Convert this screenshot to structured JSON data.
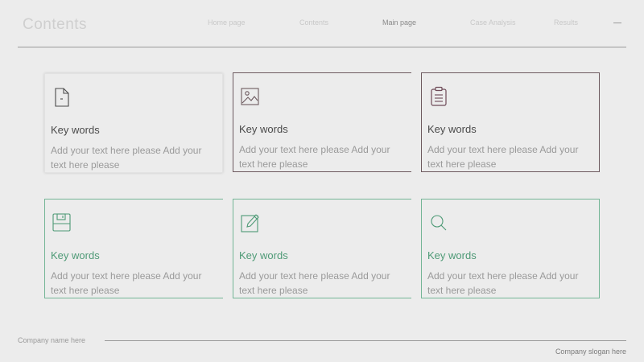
{
  "header": {
    "title": "Contents",
    "nav": [
      {
        "label": "Home page",
        "active": false
      },
      {
        "label": "Contents",
        "active": false
      },
      {
        "label": "Main page",
        "active": true
      },
      {
        "label": "Case Analysis",
        "active": false
      },
      {
        "label": "Results",
        "active": false
      }
    ]
  },
  "cards": [
    {
      "icon": "document-icon",
      "heading": "Key words",
      "body": "Add your text here please Add your text here please"
    },
    {
      "icon": "image-icon",
      "heading": "Key words",
      "body": "Add your text here please Add your text here please"
    },
    {
      "icon": "clipboard-icon",
      "heading": "Key words",
      "body": "Add your text here please Add your text here please"
    },
    {
      "icon": "save-icon",
      "heading": "Key words",
      "body": "Add your text here please Add your text here please"
    },
    {
      "icon": "edit-icon",
      "heading": "Key words",
      "body": "Add your text here please Add your text here please"
    },
    {
      "icon": "search-icon",
      "heading": "Key words",
      "body": "Add your text here please Add your text here please"
    }
  ],
  "footer": {
    "company_name": "Company name here",
    "company_slogan": "Company slogan here"
  },
  "colors": {
    "background": "#ececec",
    "dark_outline": "#6d5a5f",
    "green_accent": "#4e9a76",
    "green_outline": "#74b596"
  }
}
